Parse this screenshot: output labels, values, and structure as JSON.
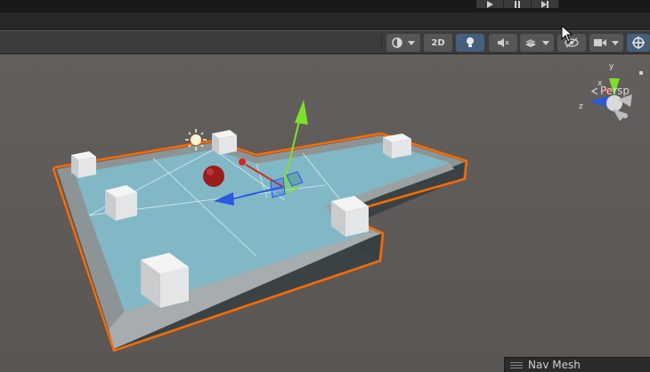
{
  "toolbar": {
    "mode_2d_label": "2D"
  },
  "scene_gizmo": {
    "projection_label": "Persp",
    "axes": {
      "x": "x",
      "y": "y",
      "z": "z"
    }
  },
  "overlay": {
    "navmesh_title": "Nav Mesh"
  },
  "colors": {
    "selection_outline": "#ff6a00",
    "navmesh": "#7fc4d6",
    "axis_x": "#d22a1a",
    "axis_y": "#7ee02a",
    "axis_z": "#2a5ae0",
    "active_button": "#46607c"
  },
  "icons": [
    "play-icon",
    "pause-icon",
    "step-icon",
    "shading-mode-icon",
    "lighting-icon",
    "audio-icon",
    "effects-icon",
    "visibility-icon",
    "camera-icon",
    "gizmos-icon",
    "sun-light-icon"
  ]
}
